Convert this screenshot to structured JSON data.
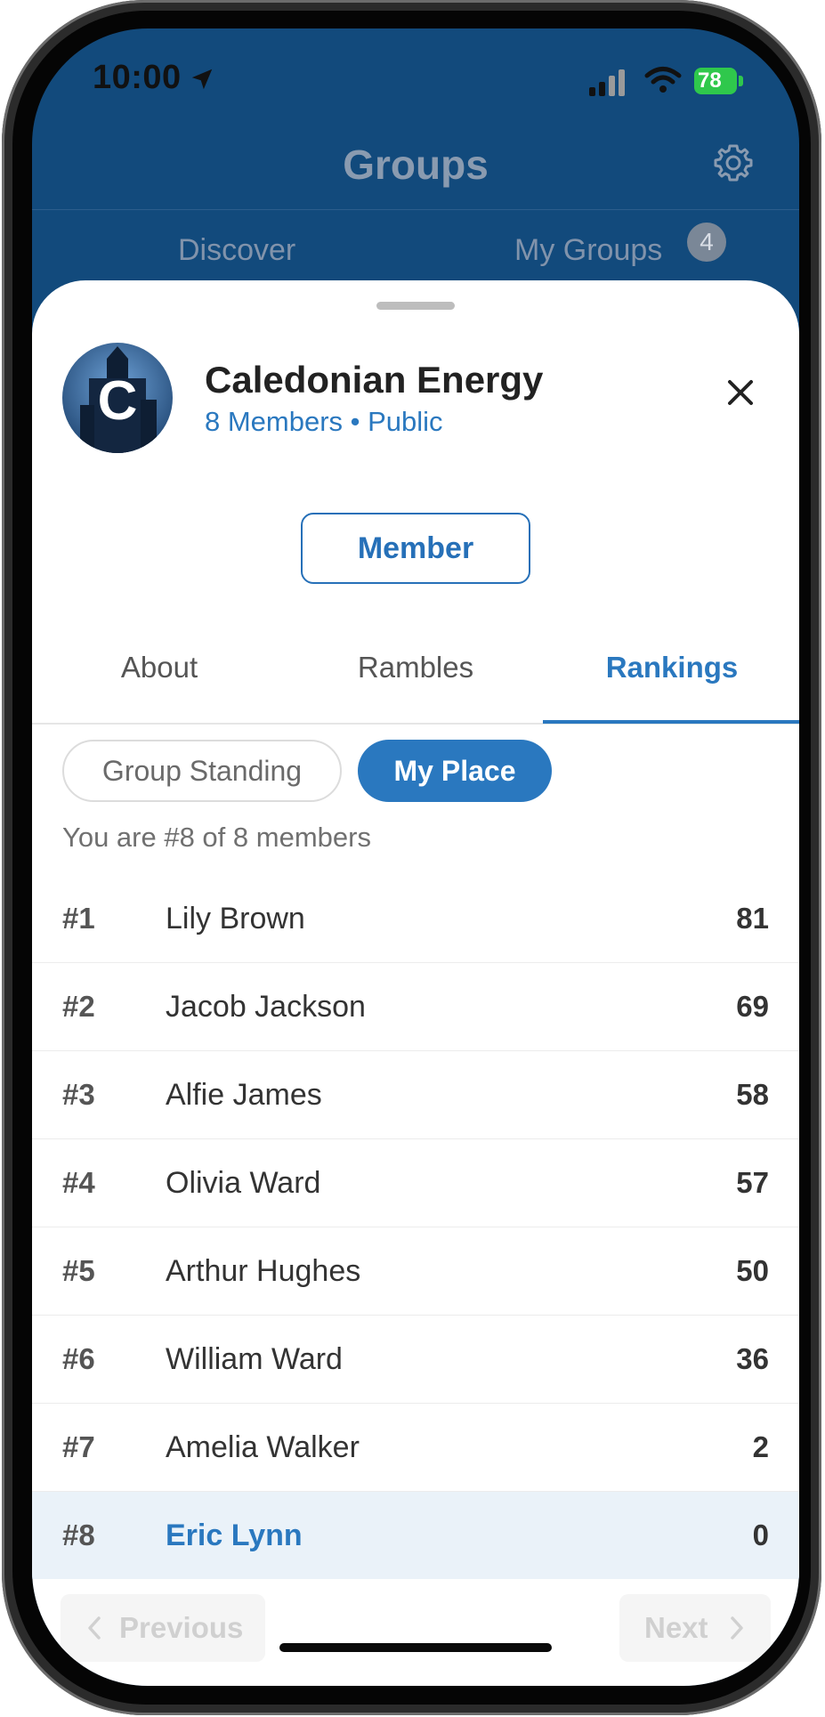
{
  "status_bar": {
    "time": "10:00",
    "battery": "78",
    "icons": [
      "location-arrow-icon",
      "cellular-signal-icon",
      "wifi-icon",
      "battery-charging-icon"
    ]
  },
  "header": {
    "title": "Groups",
    "settings_icon": "gear-icon"
  },
  "top_tabs": {
    "discover": "Discover",
    "my_groups": "My Groups",
    "my_groups_count": "4"
  },
  "group": {
    "avatar_letter": "C",
    "name": "Caledonian Energy",
    "meta": "8 Members • Public",
    "member_button": "Member",
    "close_icon": "close-icon"
  },
  "section_tabs": {
    "about": "About",
    "rambles": "Rambles",
    "rankings": "Rankings",
    "active": "Rankings"
  },
  "segmented": {
    "group_standing": "Group Standing",
    "my_place": "My Place",
    "active": "My Place"
  },
  "summary": "You are #8 of 8 members",
  "rankings": [
    {
      "pos": "#1",
      "name": "Lily Brown",
      "score": "81"
    },
    {
      "pos": "#2",
      "name": "Jacob Jackson",
      "score": "69"
    },
    {
      "pos": "#3",
      "name": "Alfie James",
      "score": "58"
    },
    {
      "pos": "#4",
      "name": "Olivia Ward",
      "score": "57"
    },
    {
      "pos": "#5",
      "name": "Arthur Hughes",
      "score": "50"
    },
    {
      "pos": "#6",
      "name": "William Ward",
      "score": "36"
    },
    {
      "pos": "#7",
      "name": "Amelia Walker",
      "score": "2"
    },
    {
      "pos": "#8",
      "name": "Eric Lynn",
      "score": "0"
    }
  ],
  "current_user_index": 7,
  "pager": {
    "previous": "Previous",
    "next": "Next",
    "previous_enabled": false,
    "next_enabled": false
  },
  "colors": {
    "header_bg": "#124a7c",
    "accent": "#2a78bf",
    "current_row_bg": "#eaf2f9",
    "battery": "#2fc84c"
  }
}
